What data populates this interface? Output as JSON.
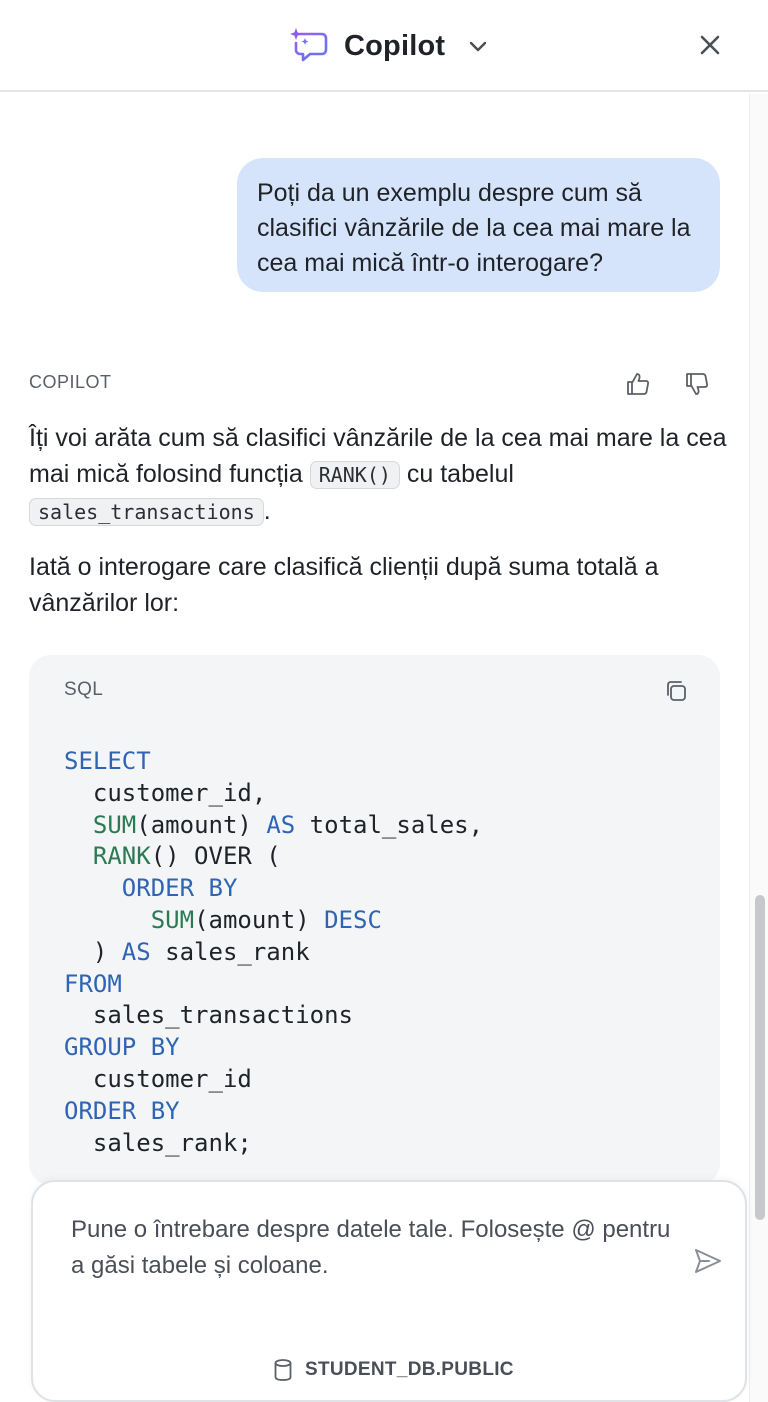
{
  "header": {
    "title": "Copilot"
  },
  "conversation": {
    "user_message": "Poți da un exemplu despre cum să clasifici vânzările de la cea mai mare la cea mai mică într-o interogare?",
    "assistant_label": "COPILOT",
    "para1": {
      "before": "Îți voi arăta cum să clasifici vânzările de la cea mai mare la cea mai mică folosind funcția ",
      "code1": "RANK()",
      "middle": " cu tabelul ",
      "code2": "sales_transactions",
      "after": "."
    },
    "para2": "Iată o interogare care clasifică clienții după suma totală a vânzărilor lor:"
  },
  "code_block": {
    "language": "SQL",
    "lines": [
      [
        {
          "t": "SELECT",
          "c": "blue"
        }
      ],
      [
        {
          "t": "  customer_id,",
          "c": ""
        }
      ],
      [
        {
          "t": "  ",
          "c": ""
        },
        {
          "t": "SUM",
          "c": "green"
        },
        {
          "t": "(amount) ",
          "c": ""
        },
        {
          "t": "AS",
          "c": "blue"
        },
        {
          "t": " total_sales,",
          "c": ""
        }
      ],
      [
        {
          "t": "  ",
          "c": ""
        },
        {
          "t": "RANK",
          "c": "green"
        },
        {
          "t": "() OVER (",
          "c": ""
        }
      ],
      [
        {
          "t": "    ",
          "c": ""
        },
        {
          "t": "ORDER BY",
          "c": "blue"
        }
      ],
      [
        {
          "t": "      ",
          "c": ""
        },
        {
          "t": "SUM",
          "c": "green"
        },
        {
          "t": "(amount) ",
          "c": ""
        },
        {
          "t": "DESC",
          "c": "blue"
        }
      ],
      [
        {
          "t": "  ) ",
          "c": ""
        },
        {
          "t": "AS",
          "c": "blue"
        },
        {
          "t": " sales_rank",
          "c": ""
        }
      ],
      [
        {
          "t": "FROM",
          "c": "blue"
        }
      ],
      [
        {
          "t": "  sales_transactions",
          "c": ""
        }
      ],
      [
        {
          "t": "GROUP BY",
          "c": "blue"
        }
      ],
      [
        {
          "t": "  customer_id",
          "c": ""
        }
      ],
      [
        {
          "t": "ORDER BY",
          "c": "blue"
        }
      ],
      [
        {
          "t": "  sales_rank;",
          "c": ""
        }
      ]
    ]
  },
  "input": {
    "placeholder": "Pune o întrebare despre datele tale. Folosește @ pentru a găsi tabele și coloane.",
    "schema": "STUDENT_DB.PUBLIC"
  },
  "colors": {
    "accent_purple": "#7b5cf0",
    "user_bubble": "#d6e4fb",
    "keyword_blue": "#2f64b5",
    "function_green": "#2c7a53"
  },
  "icons": [
    "copilot-logo-icon",
    "chevron-down-icon",
    "close-icon",
    "thumbs-up-icon",
    "thumbs-down-icon",
    "copy-icon",
    "send-icon",
    "database-icon"
  ]
}
